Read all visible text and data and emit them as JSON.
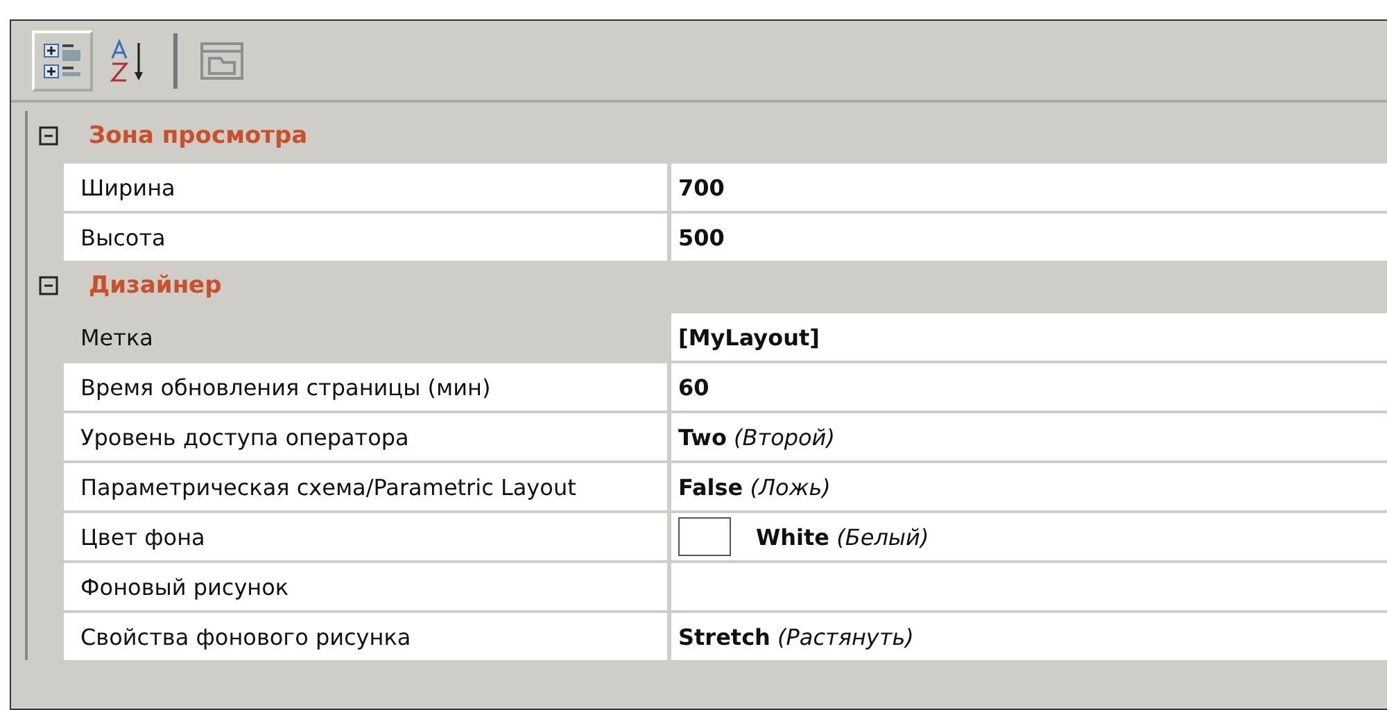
{
  "toolbar": {
    "buttons": [
      {
        "kind": "categorized",
        "selected": true,
        "disabled": false
      },
      {
        "kind": "alphabetical",
        "selected": false,
        "disabled": false
      },
      {
        "kind": "pages",
        "selected": false,
        "disabled": true
      }
    ]
  },
  "categories": [
    {
      "title": "Зона просмотра",
      "expanded": true,
      "properties": [
        {
          "name": "Ширина",
          "value": "**700**",
          "selected": false
        },
        {
          "name": "Высота",
          "value": "**500**",
          "selected": false
        }
      ]
    },
    {
      "title": "Дизайнер",
      "expanded": true,
      "properties": [
        {
          "name": "Метка",
          "value": "**[MyLayout]**",
          "selected": true
        },
        {
          "name": "Время обновления страницы (мин)",
          "value": "**60**",
          "selected": false
        },
        {
          "name": "Уровень доступа оператора",
          "value": "**Two** *(Второй)*",
          "selected": false
        },
        {
          "name": "Параметрическая схема/Parametric Layout",
          "value": "**False** *(Ложь)*",
          "selected": false
        },
        {
          "name": "Цвет фона",
          "value": "**White** *(Белый)*",
          "color": "#ffffff",
          "selected": false
        },
        {
          "name": "Фоновый рисунок",
          "selected": false
        },
        {
          "name": "Свойства фонового рисунка",
          "value": "**Stretch** *(Растянуть)*",
          "selected": false
        }
      ]
    }
  ]
}
